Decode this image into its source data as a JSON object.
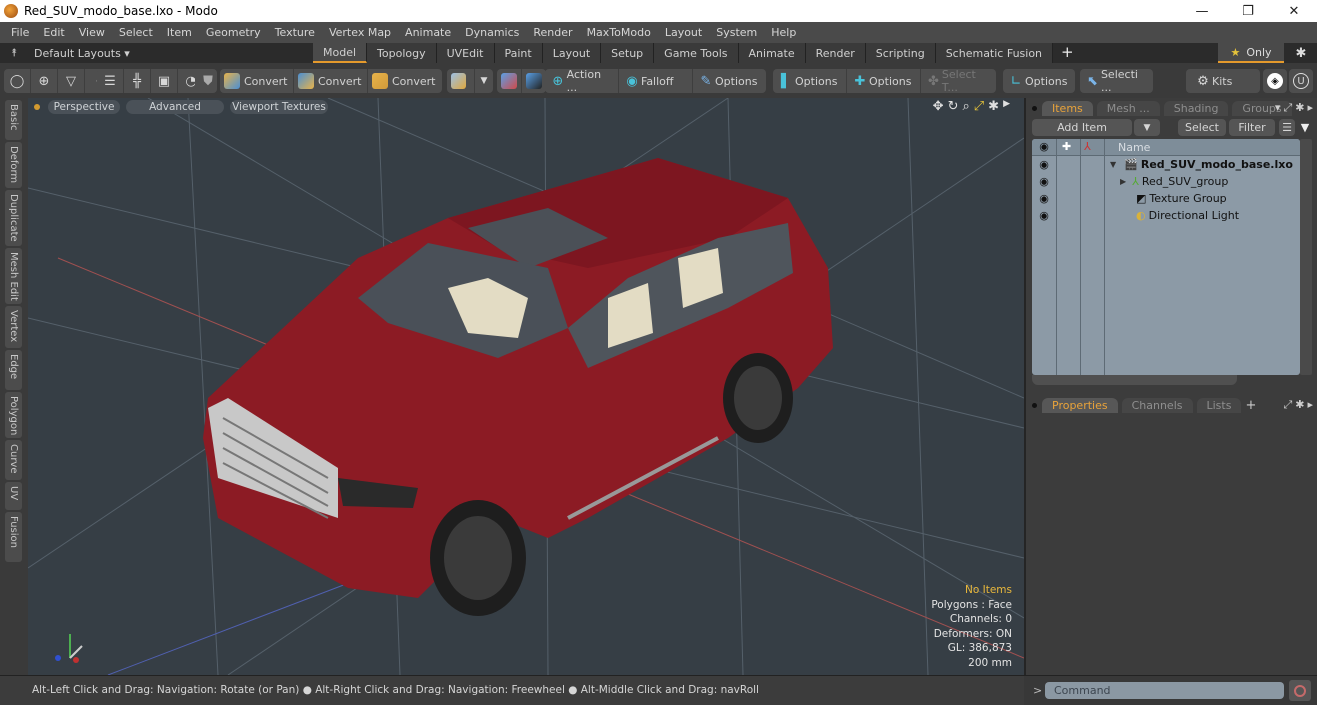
{
  "window": {
    "title": "Red_SUV_modo_base.lxo - Modo",
    "controls": {
      "minimize": "—",
      "restore": "❐",
      "close": "✕"
    }
  },
  "menu": [
    "File",
    "Edit",
    "View",
    "Select",
    "Item",
    "Geometry",
    "Texture",
    "Vertex Map",
    "Animate",
    "Dynamics",
    "Render",
    "MaxToModo",
    "Layout",
    "System",
    "Help"
  ],
  "layout_bar": {
    "default_layouts": "Default Layouts ▾",
    "tabs": [
      "Model",
      "Topology",
      "UVEdit",
      "Paint",
      "Layout",
      "Setup",
      "Game Tools",
      "Animate",
      "Render",
      "Scripting",
      "Schematic Fusion"
    ],
    "active_tab": "Model",
    "add_tab": "+",
    "only_label": "Only"
  },
  "toolbar": {
    "convert_1": "Convert",
    "convert_2": "Convert",
    "convert_3": "Convert",
    "action": "Action ...",
    "falloff": "Falloff",
    "options_1": "Options",
    "options_2": "Options",
    "options_3": "Options",
    "select_t": "Select T...",
    "options_4": "Options",
    "selecti": "Selecti ...",
    "kits": "Kits"
  },
  "left_tabs": [
    "Basic",
    "Deform",
    "Duplicate",
    "Mesh Edit",
    "Vertex",
    "Edge",
    "Polygon",
    "Curve",
    "UV",
    "Fusion"
  ],
  "viewport": {
    "view_mode": "Perspective",
    "shading": "Advanced",
    "textures": "Viewport Textures",
    "info": {
      "selection": "No Items",
      "polygons": "Polygons : Face",
      "channels": "Channels: 0",
      "deformers": "Deformers: ON",
      "gl": "GL: 386,873",
      "grid": "200 mm"
    },
    "colors": {
      "background": "#363e45",
      "body": "#8c1b24",
      "seat": "#e3dcc4"
    }
  },
  "status_bar": {
    "hint": "Alt-Left Click and Drag: Navigation: Rotate (or Pan) ● Alt-Right Click and Drag: Navigation: Freewheel ● Alt-Middle Click and Drag: navRoll"
  },
  "items_panel": {
    "tabs": [
      "Items",
      "Mesh ...",
      "Shading",
      "Groups"
    ],
    "active_tab": "Items",
    "add_item": "Add Item",
    "select": "Select",
    "filter": "Filter",
    "column_name": "Name",
    "items": [
      {
        "name": "Red_SUV_modo_base.lxo",
        "type": "scene",
        "expanded": true,
        "bold": true
      },
      {
        "name": "Red_SUV_group",
        "type": "group",
        "expanded": false,
        "bold": false
      },
      {
        "name": "Texture Group",
        "type": "texture",
        "bold": false
      },
      {
        "name": "Directional Light",
        "type": "light",
        "bold": false
      }
    ]
  },
  "properties_panel": {
    "tabs": [
      "Properties",
      "Channels",
      "Lists"
    ],
    "active_tab": "Properties",
    "add_tab": "+"
  },
  "command": {
    "prompt": ">",
    "placeholder": "Command"
  }
}
